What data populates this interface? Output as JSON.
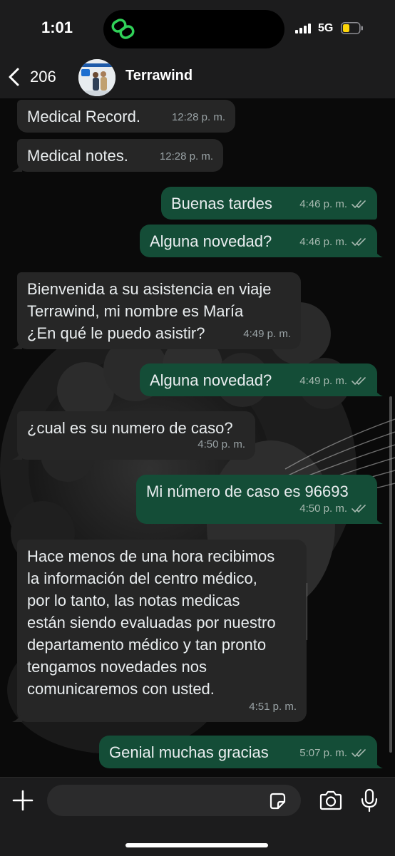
{
  "status_bar": {
    "time": "1:01",
    "network": "5G",
    "battery_color": "#ffd60a",
    "island_icon": "link-rings-icon",
    "island_icon_color": "#30d158"
  },
  "header": {
    "back_count": "206",
    "contact_name": "Terrawind"
  },
  "colors": {
    "incoming_bubble": "#262626",
    "outgoing_bubble": "#144d37",
    "read_ticks": "#a7b9b0"
  },
  "messages": [
    {
      "direction": "in",
      "text": "Medical Record.",
      "time": "12:28 p. m."
    },
    {
      "direction": "in",
      "text": "Medical notes.",
      "time": "12:28 p. m."
    },
    {
      "direction": "out",
      "text": "Buenas tardes",
      "time": "4:46 p. m.",
      "status": "read"
    },
    {
      "direction": "out",
      "text": "Alguna novedad?",
      "time": "4:46 p. m.",
      "status": "read"
    },
    {
      "direction": "in",
      "text": "Bienvenida a su asistencia en viaje\nTerrawind, mi nombre es María\n¿En qué le puedo asistir?",
      "time": "4:49 p. m."
    },
    {
      "direction": "out",
      "text": "Alguna novedad?",
      "time": "4:49 p. m.",
      "status": "read"
    },
    {
      "direction": "in",
      "text": "¿cual es su numero de caso?",
      "time": "4:50 p. m."
    },
    {
      "direction": "out",
      "text": "Mi número de caso es 96693",
      "time": "4:50 p. m.",
      "status": "read"
    },
    {
      "direction": "in",
      "text": "Hace menos de una hora recibimos\nla información del centro médico,\npor lo tanto, las notas medicas\nestán siendo evaluadas por nuestro\ndepartamento médico y tan pronto\ntengamos novedades nos\ncomunicaremos con usted.",
      "time": "4:51 p. m."
    },
    {
      "direction": "out",
      "text": "Genial muchas gracias",
      "time": "5:07 p. m.",
      "status": "read"
    }
  ],
  "input": {
    "placeholder": "",
    "value": "",
    "icons": [
      "plus-icon",
      "sticker-icon",
      "camera-icon",
      "microphone-icon"
    ]
  }
}
